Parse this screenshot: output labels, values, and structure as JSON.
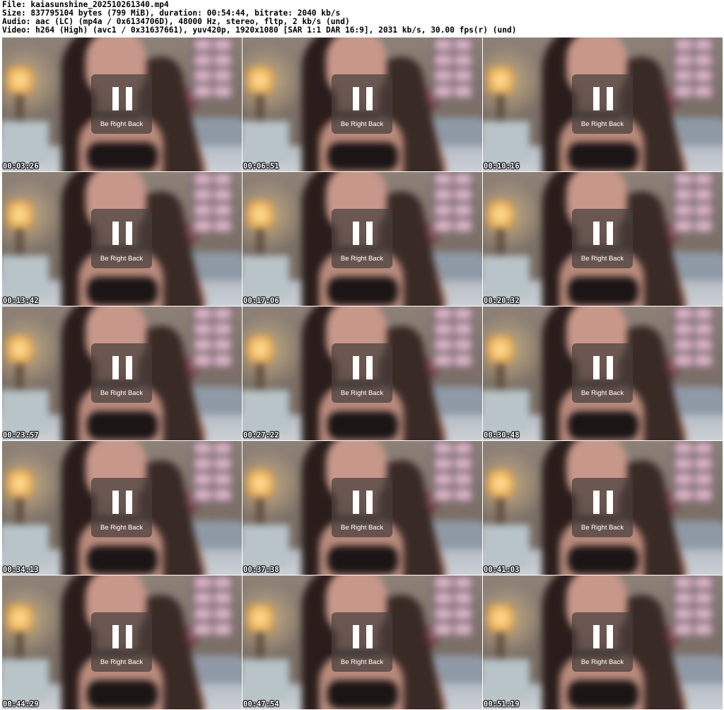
{
  "header": {
    "lines": [
      "File: kaiasunshine_202510261340.mp4",
      "Size: 837795104 bytes (799 MiB), duration: 00:54:44, bitrate: 2040 kb/s",
      "Audio: aac (LC) (mp4a / 0x6134706D), 48000 Hz, stereo, fltp, 2 kb/s (und)",
      "Video: h264 (High) (avc1 / 0x31637661), yuv420p, 1920x1080 [SAR 1:1 DAR 16:9], 2031 kb/s, 30.00 fps(r) (und)"
    ]
  },
  "overlay": {
    "label": "Be Right Back"
  },
  "thumbnails": [
    {
      "timestamp": "00:03:26"
    },
    {
      "timestamp": "00:06:51"
    },
    {
      "timestamp": "00:10:16"
    },
    {
      "timestamp": "00:13:42"
    },
    {
      "timestamp": "00:17:06"
    },
    {
      "timestamp": "00:20:32"
    },
    {
      "timestamp": "00:23:57"
    },
    {
      "timestamp": "00:27:22"
    },
    {
      "timestamp": "00:30:48"
    },
    {
      "timestamp": "00:34:13"
    },
    {
      "timestamp": "00:37:38"
    },
    {
      "timestamp": "00:41:03"
    },
    {
      "timestamp": "00:44:29"
    },
    {
      "timestamp": "00:47:54"
    },
    {
      "timestamp": "00:51:19"
    }
  ]
}
